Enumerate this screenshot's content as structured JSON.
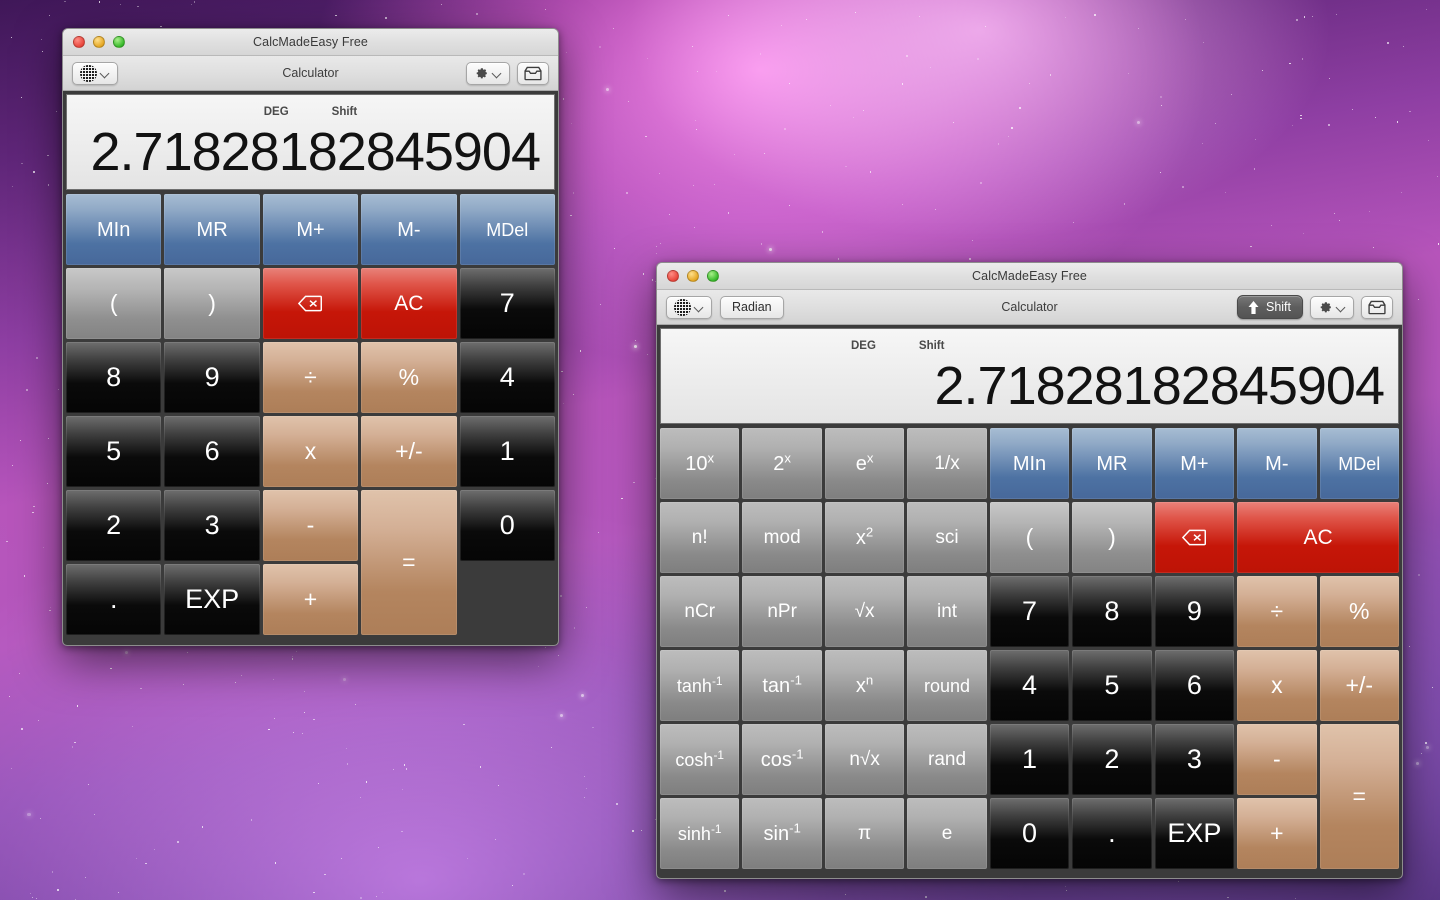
{
  "desktop": {
    "wallpaper_name": "nebula-galaxy-wallpaper"
  },
  "window_basic": {
    "title": "CalcMadeEasy Free",
    "toolbar": {
      "center_label": "Calculator",
      "language_icon": "globe-icon",
      "language_chevron_icon": "chevron-down-icon",
      "gear_icon": "gear-icon",
      "gear_chevron_icon": "chevron-down-icon",
      "inbox_icon": "inbox-tray-icon"
    },
    "traffic_lights": {
      "close": "close-button",
      "minimize": "minimize-button",
      "zoom": "zoom-button",
      "close_color": "#e8463c",
      "minimize_color": "#e5a723",
      "zoom_color": "#38b92b"
    },
    "display": {
      "mode_flag": "DEG",
      "shift_flag": "Shift",
      "value": "2.71828182845904"
    },
    "keys": [
      {
        "label": "MIn",
        "style": "blue",
        "name": "key-memory-in",
        "col": 1
      },
      {
        "label": "MR",
        "style": "blue",
        "name": "key-memory-recall",
        "col": 1
      },
      {
        "label": "M+",
        "style": "blue",
        "name": "key-memory-plus",
        "col": 1
      },
      {
        "label": "M-",
        "style": "blue",
        "name": "key-memory-minus",
        "col": 1
      },
      {
        "label": "MDel",
        "style": "blue",
        "name": "key-memory-delete",
        "col": 1
      },
      {
        "label": "(",
        "style": "gray",
        "name": "key-paren-open",
        "col": 1
      },
      {
        "label": ")",
        "style": "gray",
        "name": "key-paren-close",
        "col": 1
      },
      {
        "label": "⌫",
        "style": "red",
        "name": "key-backspace",
        "col": 1,
        "icon": "backspace-icon"
      },
      {
        "label": "AC",
        "style": "red",
        "name": "key-all-clear",
        "col": 2
      },
      {
        "label": "7",
        "style": "dark",
        "name": "key-7",
        "col": 1
      },
      {
        "label": "8",
        "style": "dark",
        "name": "key-8",
        "col": 1
      },
      {
        "label": "9",
        "style": "dark",
        "name": "key-9",
        "col": 1
      },
      {
        "label": "÷",
        "style": "tan",
        "name": "key-divide",
        "col": 1
      },
      {
        "label": "%",
        "style": "tan",
        "name": "key-percent",
        "col": 1
      },
      {
        "label": "4",
        "style": "dark",
        "name": "key-4",
        "col": 1
      },
      {
        "label": "5",
        "style": "dark",
        "name": "key-5",
        "col": 1
      },
      {
        "label": "6",
        "style": "dark",
        "name": "key-6",
        "col": 1
      },
      {
        "label": "x",
        "style": "tan",
        "name": "key-multiply",
        "col": 1
      },
      {
        "label": "+/-",
        "style": "tan",
        "name": "key-sign-toggle",
        "col": 1
      },
      {
        "label": "1",
        "style": "dark",
        "name": "key-1",
        "col": 1
      },
      {
        "label": "2",
        "style": "dark",
        "name": "key-2",
        "col": 1
      },
      {
        "label": "3",
        "style": "dark",
        "name": "key-3",
        "col": 1
      },
      {
        "label": "-",
        "style": "tan",
        "name": "key-subtract",
        "col": 1
      },
      {
        "label": "=",
        "style": "tan",
        "name": "key-equals",
        "col": 1,
        "rowspan": 2
      },
      {
        "label": "0",
        "style": "dark",
        "name": "key-0",
        "col": 1
      },
      {
        "label": ".",
        "style": "dark",
        "name": "key-decimal",
        "col": 1
      },
      {
        "label": "EXP",
        "style": "dark",
        "name": "key-exp",
        "col": 1
      },
      {
        "label": "+",
        "style": "tan",
        "name": "key-add",
        "col": 1
      }
    ]
  },
  "window_scientific": {
    "title": "CalcMadeEasy Free",
    "toolbar": {
      "center_label": "Calculator",
      "angle_mode_label": "Radian",
      "shift_label": "Shift",
      "shift_active": true,
      "language_icon": "globe-icon",
      "language_chevron_icon": "chevron-down-icon",
      "shift_icon": "up-arrow-icon",
      "gear_icon": "gear-icon",
      "gear_chevron_icon": "chevron-down-icon",
      "inbox_icon": "inbox-tray-icon"
    },
    "traffic_lights": {
      "close": "close-button",
      "minimize": "minimize-button",
      "zoom": "zoom-button"
    },
    "display": {
      "mode_flag": "DEG",
      "shift_flag": "Shift",
      "value": "2.71828182845904"
    },
    "keys": [
      {
        "label": "10",
        "sup": "x",
        "style": "gray2",
        "name": "key-ten-power-x"
      },
      {
        "label": "2",
        "sup": "x",
        "style": "gray2",
        "name": "key-two-power-x"
      },
      {
        "label": "e",
        "sup": "x",
        "style": "gray2",
        "name": "key-e-power-x"
      },
      {
        "label": "1/x",
        "style": "gray2",
        "name": "key-reciprocal"
      },
      {
        "label": "MIn",
        "style": "blue",
        "name": "key-memory-in"
      },
      {
        "label": "MR",
        "style": "blue",
        "name": "key-memory-recall"
      },
      {
        "label": "M+",
        "style": "blue",
        "name": "key-memory-plus"
      },
      {
        "label": "M-",
        "style": "blue",
        "name": "key-memory-minus"
      },
      {
        "label": "MDel",
        "style": "blue",
        "name": "key-memory-delete"
      },
      {
        "label": "n!",
        "style": "gray2",
        "name": "key-factorial"
      },
      {
        "label": "mod",
        "style": "gray2",
        "name": "key-modulo"
      },
      {
        "label": "x",
        "sup": "2",
        "style": "gray2",
        "name": "key-x-squared"
      },
      {
        "label": "sci",
        "style": "gray2",
        "name": "key-scientific-notation"
      },
      {
        "label": "(",
        "style": "gray",
        "name": "key-paren-open"
      },
      {
        "label": ")",
        "style": "gray",
        "name": "key-paren-close"
      },
      {
        "label": "⌫",
        "style": "red",
        "name": "key-backspace",
        "icon": "backspace-icon"
      },
      {
        "label": "AC",
        "style": "red",
        "name": "key-all-clear",
        "colspan": 2
      },
      {
        "label": "nCr",
        "style": "gray2",
        "name": "key-combinations"
      },
      {
        "label": "nPr",
        "style": "gray2",
        "name": "key-permutations"
      },
      {
        "label": "√x",
        "style": "gray2",
        "name": "key-square-root"
      },
      {
        "label": "int",
        "style": "gray2",
        "name": "key-integer"
      },
      {
        "label": "7",
        "style": "dark",
        "name": "key-7"
      },
      {
        "label": "8",
        "style": "dark",
        "name": "key-8"
      },
      {
        "label": "9",
        "style": "dark",
        "name": "key-9"
      },
      {
        "label": "÷",
        "style": "tan",
        "name": "key-divide"
      },
      {
        "label": "%",
        "style": "tan",
        "name": "key-percent"
      },
      {
        "label": "tanh",
        "sup": "-1",
        "style": "gray2",
        "name": "key-arctanh"
      },
      {
        "label": "tan",
        "sup": "-1",
        "style": "gray2",
        "name": "key-arctan"
      },
      {
        "label": "x",
        "sup": "n",
        "style": "gray2",
        "name": "key-x-power-n"
      },
      {
        "label": "round",
        "style": "gray2",
        "name": "key-round"
      },
      {
        "label": "4",
        "style": "dark",
        "name": "key-4"
      },
      {
        "label": "5",
        "style": "dark",
        "name": "key-5"
      },
      {
        "label": "6",
        "style": "dark",
        "name": "key-6"
      },
      {
        "label": "x",
        "style": "tan",
        "name": "key-multiply"
      },
      {
        "label": "+/-",
        "style": "tan",
        "name": "key-sign-toggle"
      },
      {
        "label": "cosh",
        "sup": "-1",
        "style": "gray2",
        "name": "key-arccosh"
      },
      {
        "label": "cos",
        "sup": "-1",
        "style": "gray2",
        "name": "key-arccos"
      },
      {
        "label": "n√x",
        "style": "gray2",
        "name": "key-nth-root"
      },
      {
        "label": "rand",
        "style": "gray2",
        "name": "key-random"
      },
      {
        "label": "1",
        "style": "dark",
        "name": "key-1"
      },
      {
        "label": "2",
        "style": "dark",
        "name": "key-2"
      },
      {
        "label": "3",
        "style": "dark",
        "name": "key-3"
      },
      {
        "label": "-",
        "style": "tan",
        "name": "key-subtract"
      },
      {
        "label": "=",
        "style": "tan",
        "name": "key-equals",
        "rowspan": 2
      },
      {
        "label": "sinh",
        "sup": "-1",
        "style": "gray2",
        "name": "key-arcsinh"
      },
      {
        "label": "sin",
        "sup": "-1",
        "style": "gray2",
        "name": "key-arcsin"
      },
      {
        "label": "π",
        "style": "gray2",
        "name": "key-pi"
      },
      {
        "label": "e",
        "style": "gray2",
        "name": "key-euler"
      },
      {
        "label": "0",
        "style": "dark",
        "name": "key-0"
      },
      {
        "label": ".",
        "style": "dark",
        "name": "key-decimal"
      },
      {
        "label": "EXP",
        "style": "dark",
        "name": "key-exp"
      },
      {
        "label": "+",
        "style": "tan",
        "name": "key-add"
      }
    ]
  }
}
